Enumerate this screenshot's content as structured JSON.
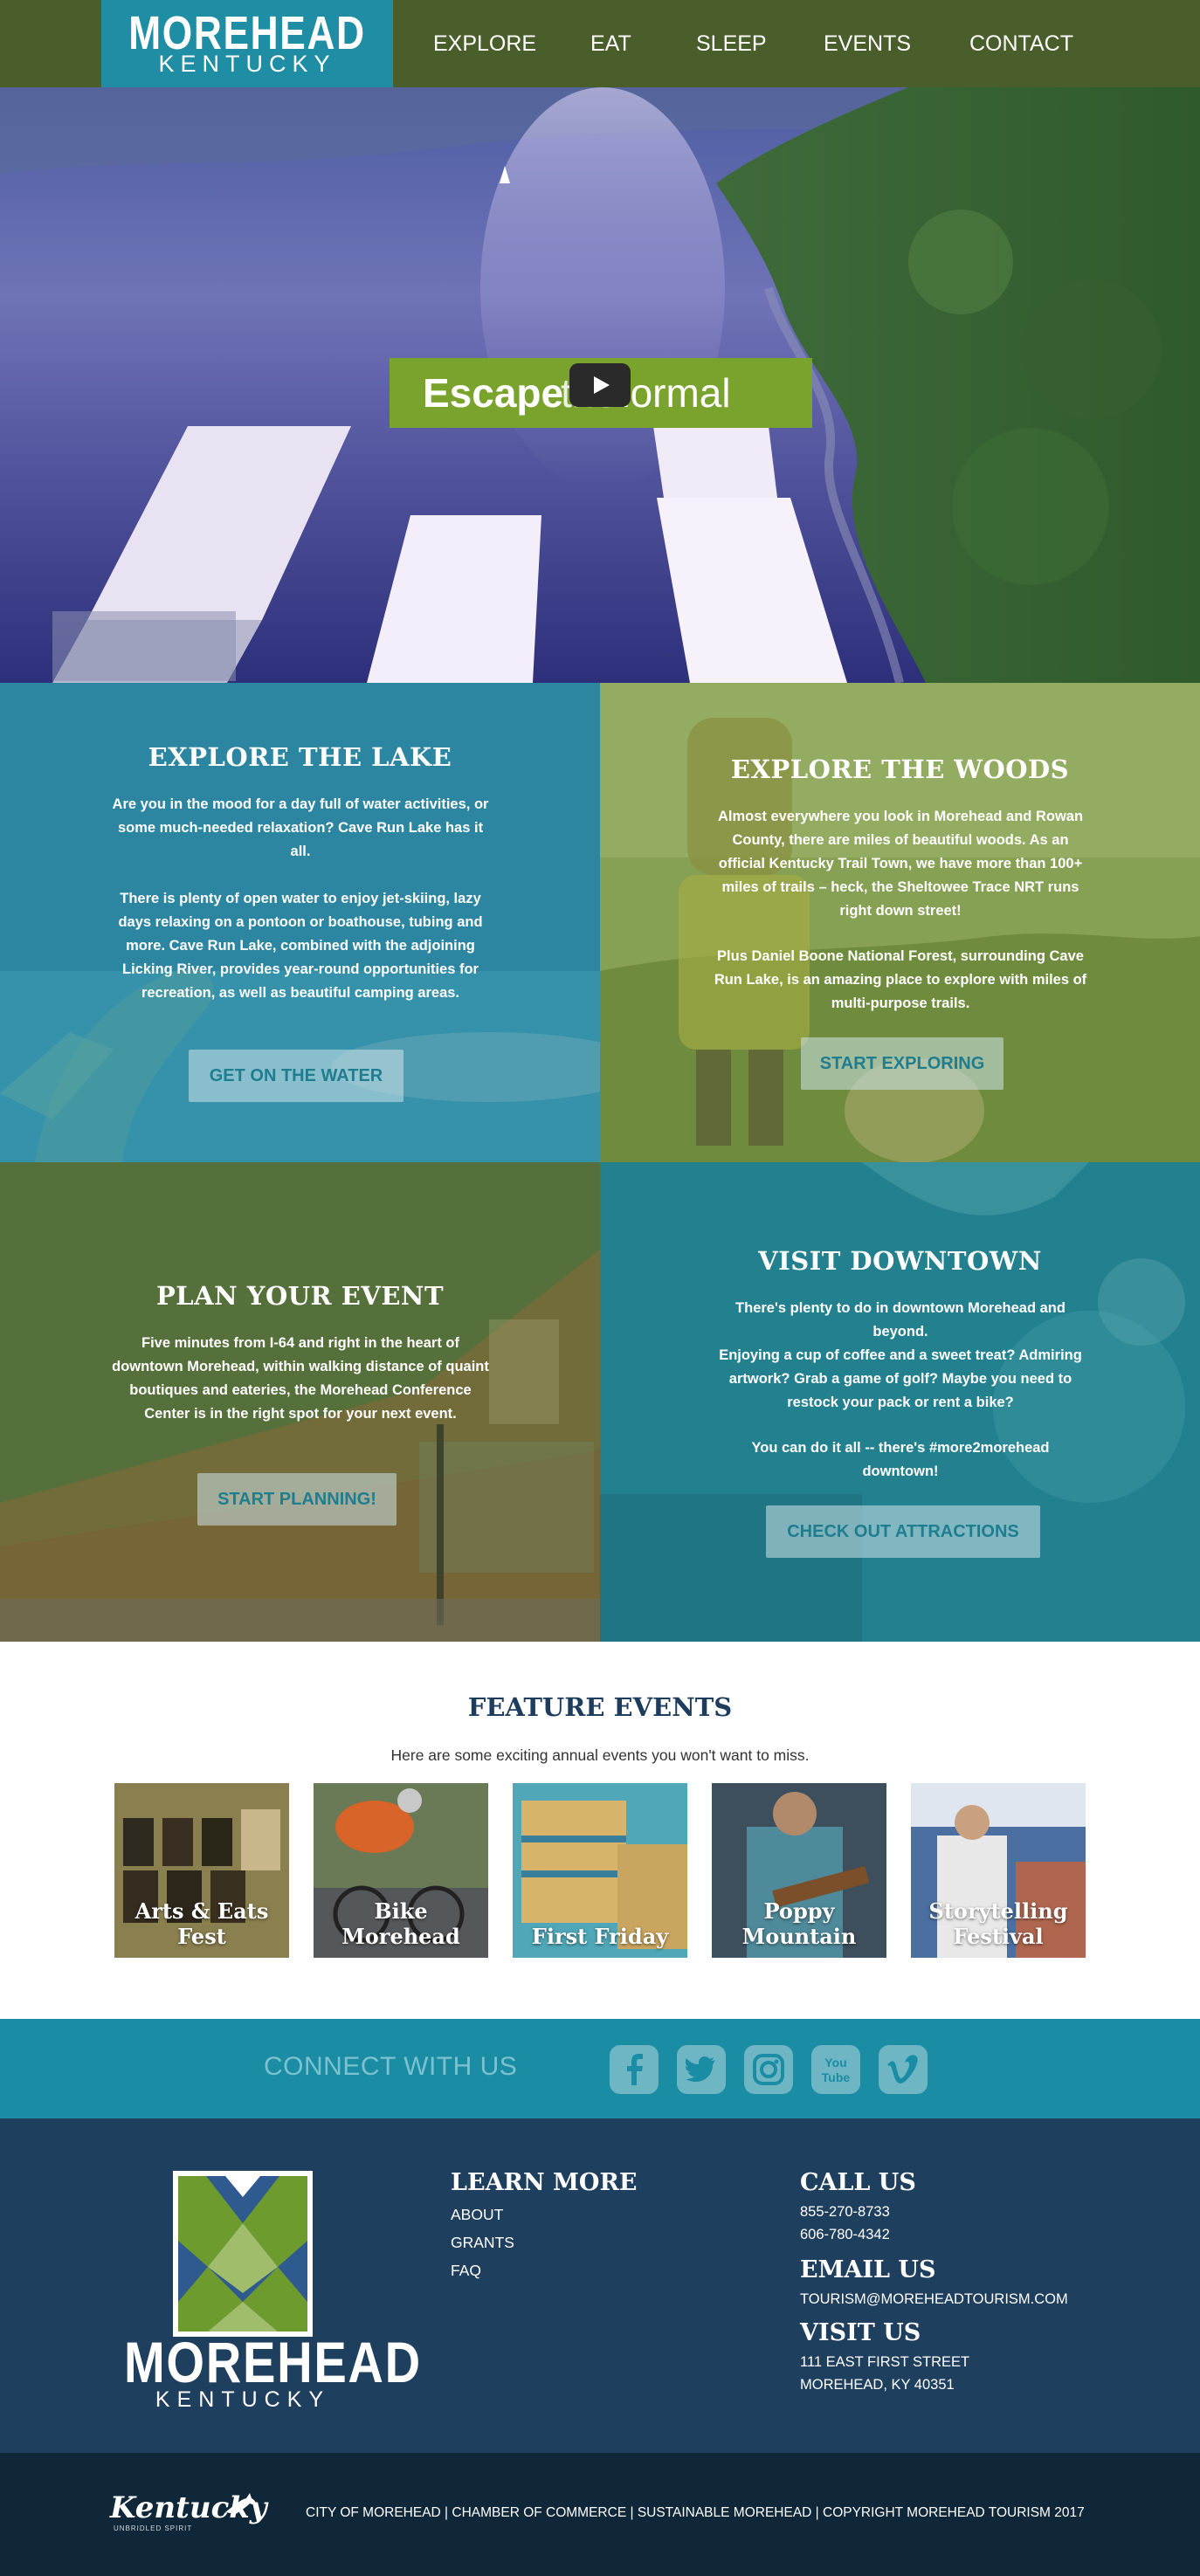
{
  "header": {
    "logo_main": "MOREHEAD",
    "logo_sub": "KENTUCKY",
    "nav": [
      "EXPLORE",
      "EAT",
      "SLEEP",
      "EVENTS",
      "CONTACT"
    ]
  },
  "hero": {
    "banner_word1": "Escape",
    "banner_word2": "the",
    "banner_word3": "normal"
  },
  "tiles": {
    "lake": {
      "title": "EXPLORE THE LAKE",
      "text1": "Are you in the mood for a day full of water activities, or some much-needed relaxation? Cave Run Lake has it all.",
      "text2": "There is plenty of open water to enjoy jet-skiing, lazy days relaxing on a pontoon or boathouse, tubing and more. Cave Run Lake, combined with the adjoining Licking River, provides year-round opportunities for recreation, as well as beautiful camping areas.",
      "button": "GET ON THE WATER"
    },
    "woods": {
      "title": "EXPLORE THE WOODS",
      "text1": "Almost everywhere you look in Morehead and Rowan County, there are miles of beautiful woods. As an official Kentucky Trail Town, we have more than 100+ miles of trails – heck, the Sheltowee Trace NRT runs right down street!",
      "text2": "Plus Daniel Boone National Forest, surrounding Cave Run Lake, is an amazing place to explore with miles of multi-purpose trails.",
      "button": "START EXPLORING"
    },
    "event": {
      "title": "PLAN YOUR EVENT",
      "text1": "Five minutes from I-64 and right in the heart of downtown Morehead, within walking distance of quaint boutiques and eateries, the Morehead Conference Center is in the right spot for your next event.",
      "button": "START PLANNING!"
    },
    "downtown": {
      "title": "VISIT DOWNTOWN",
      "text1": "There's plenty to do in downtown Morehead and beyond.\nEnjoying a cup of coffee and a sweet treat? Admiring artwork? Grab a game of golf? Maybe you need to restock your pack or rent a bike?",
      "text2": "You can do it all -- there's #more2morehead downtown!",
      "button": "CHECK OUT ATTRACTIONS"
    }
  },
  "features": {
    "title": "FEATURE EVENTS",
    "subtitle": "Here are some exciting annual events you won't want to miss.",
    "events": [
      "Arts & Eats\nFest",
      "Bike\nMorehead",
      "First Friday",
      "Poppy\nMountain",
      "Storytelling\nFestival"
    ]
  },
  "connect": {
    "label": "CONNECT WITH US",
    "icons": [
      "facebook-icon",
      "twitter-icon",
      "instagram-icon",
      "youtube-icon",
      "vimeo-icon"
    ],
    "youtube_text_1": "You",
    "youtube_text_2": "Tube"
  },
  "footer": {
    "logo_main": "MOREHEAD",
    "logo_sub": "KENTUCKY",
    "learn_more": {
      "title": "LEARN MORE",
      "links": [
        "ABOUT",
        "GRANTS",
        "FAQ"
      ]
    },
    "call_us": {
      "title": "CALL US",
      "phones": [
        "855-270-8733",
        "606-780-4342"
      ]
    },
    "email_us": {
      "title": "EMAIL US",
      "email": "TOURISM@MOREHEADTOURISM.COM"
    },
    "visit_us": {
      "title": "VISIT US",
      "address1": "111 EAST FIRST STREET",
      "address2": "MOREHEAD, KY 40351"
    }
  },
  "bottom": {
    "kentucky_logo": "Kentucky",
    "kentucky_tagline": "UNBRIDLED SPIRIT",
    "links": [
      "CITY OF MOREHEAD",
      "CHAMBER OF COMMERCE",
      "SUSTAINABLE MOREHEAD",
      "COPYRIGHT MOREHEAD TOURISM 2017"
    ],
    "separator": " | "
  },
  "colors": {
    "header_green": "#4a5e2b",
    "logo_teal": "#1f8ea5",
    "connect_teal": "#1a8ca4",
    "footer_navy": "#1f3f5f",
    "bottom_navy": "#0f2739",
    "title_navy": "#1e3d5e"
  }
}
